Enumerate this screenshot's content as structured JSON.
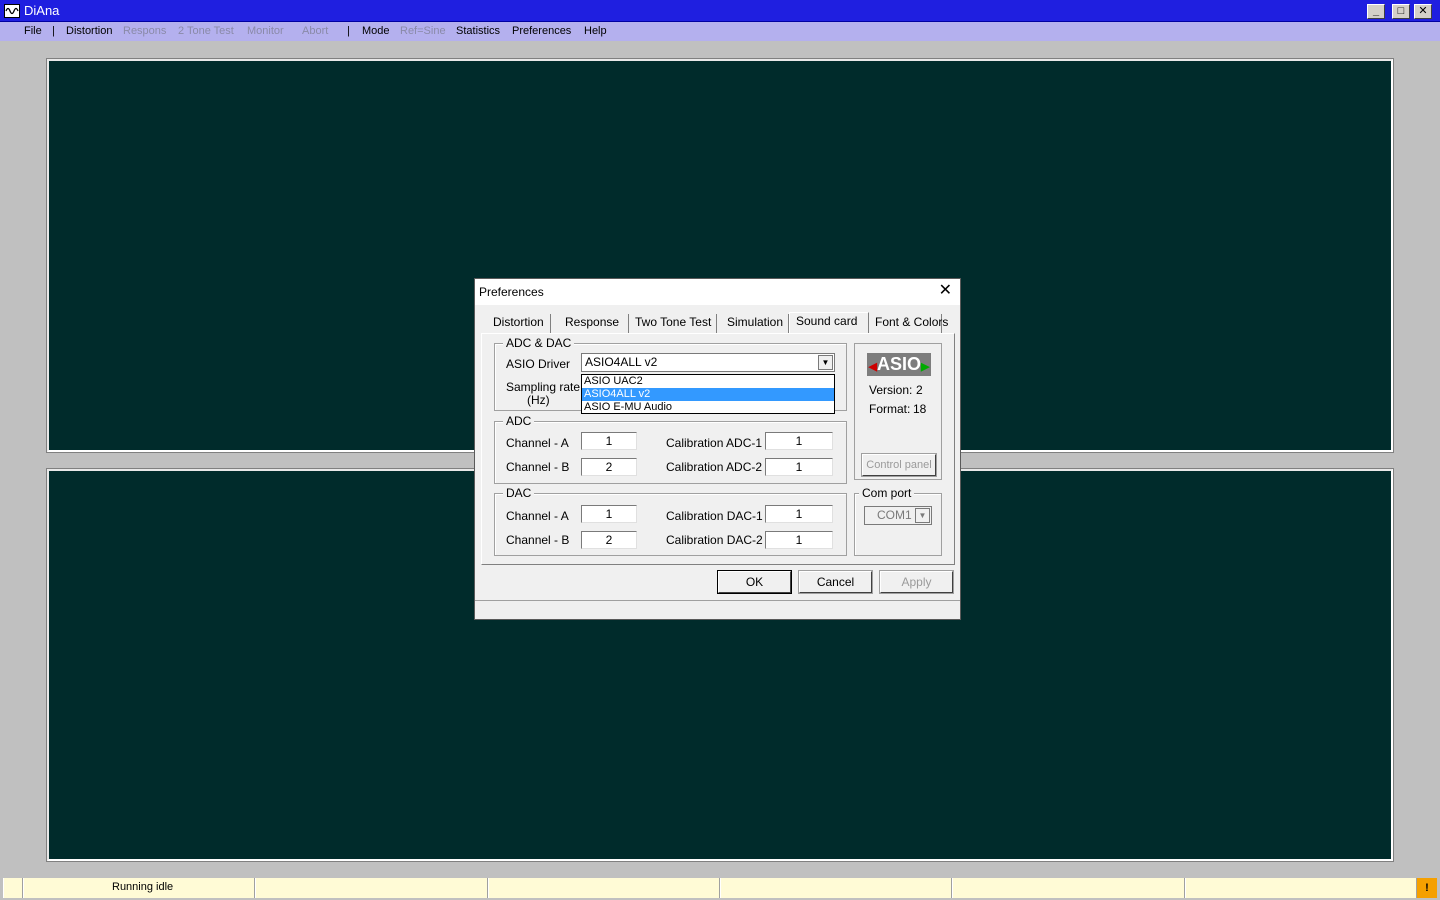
{
  "window": {
    "title": "DiAna",
    "min_label": "_",
    "max_label": "□",
    "close_label": "✕"
  },
  "menu": {
    "file": "File",
    "sep1": "|",
    "distortion": "Distortion",
    "respons": "Respons",
    "two_tone_test": "2 Tone Test",
    "monitor": "Monitor",
    "abort": "Abort",
    "sep2": "|",
    "mode": "Mode",
    "ref_sine": "Ref=Sine",
    "statistics": "Statistics",
    "preferences": "Preferences",
    "help": "Help"
  },
  "status": {
    "text": "Running idle",
    "warn_label": "!"
  },
  "dialog": {
    "title": "Preferences",
    "close_label": "✕",
    "tabs": [
      "Distortion",
      "Response",
      "Two Tone Test",
      "Simulation",
      "Sound card",
      "Font & Colors"
    ],
    "active_tab": "Sound card",
    "adc_dac": {
      "group_label": "ADC & DAC",
      "asio_driver_label": "ASIO Driver",
      "asio_driver_value": "ASIO4ALL v2",
      "sampling_rate_label": "Sampling rate",
      "sampling_rate_unit": "(Hz)",
      "dropdown_options": [
        "ASIO UAC2",
        "ASIO4ALL v2",
        "ASIO E-MU Audio"
      ],
      "dropdown_selected": "ASIO4ALL v2"
    },
    "adc": {
      "group_label": "ADC",
      "channel_a_label": "Channel - A",
      "channel_a_value": "1",
      "channel_b_label": "Channel - B",
      "channel_b_value": "2",
      "cal1_label": "Calibration ADC-1",
      "cal1_value": "1",
      "cal2_label": "Calibration ADC-2",
      "cal2_value": "1"
    },
    "dac": {
      "group_label": "DAC",
      "channel_a_label": "Channel - A",
      "channel_a_value": "1",
      "channel_b_label": "Channel - B",
      "channel_b_value": "2",
      "cal1_label": "Calibration DAC-1",
      "cal1_value": "1",
      "cal2_label": "Calibration DAC-2",
      "cal2_value": "1"
    },
    "asio_info": {
      "logo_text": "ASIO",
      "version_label": "Version:",
      "version_value": "2",
      "format_label": "Format:",
      "format_value": "18",
      "control_panel_label": "Control panel"
    },
    "com_port": {
      "group_label": "Com port",
      "value": "COM1"
    },
    "buttons": {
      "ok": "OK",
      "cancel": "Cancel",
      "apply": "Apply"
    }
  },
  "colors": {
    "title_bar": "#1f1fe0",
    "menu_bar": "#b4b0ee",
    "scope_background": "#002b2b",
    "status_bar": "#fffbd6",
    "status_warning": "#f5a000",
    "dropdown_selection": "#3399ff"
  }
}
